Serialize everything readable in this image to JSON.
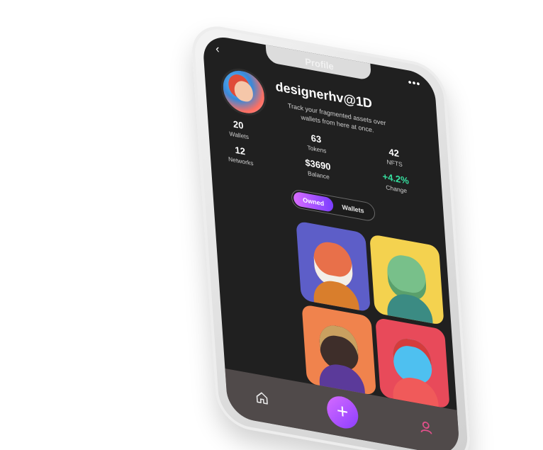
{
  "header": {
    "title": "Profile",
    "back_icon": "chevron-left-icon",
    "more_icon": "more-horizontal-icon"
  },
  "profile": {
    "username": "designerhv@1D",
    "tagline": "Track your fragmented assets over wallets from here at once."
  },
  "stats": [
    {
      "value": "20",
      "label": "Wallets"
    },
    {
      "value": "63",
      "label": "Tokens"
    },
    {
      "value": "42",
      "label": "NFTS"
    },
    {
      "value": "12",
      "label": "Networks"
    },
    {
      "value": "$3690",
      "label": "Balance"
    },
    {
      "value": "+4.2%",
      "label": "Change"
    }
  ],
  "toggle": {
    "owned": "Owned",
    "wallets": "Wallets"
  },
  "tabbar": {
    "home_icon": "home-icon",
    "add_icon": "plus-icon",
    "profile_icon": "user-icon",
    "add_symbol": "+"
  },
  "colors": {
    "screen_bg": "#202020",
    "accent_gradient_start": "#d86cff",
    "accent_gradient_end": "#7a3dff",
    "positive_change": "#36e0a0"
  }
}
